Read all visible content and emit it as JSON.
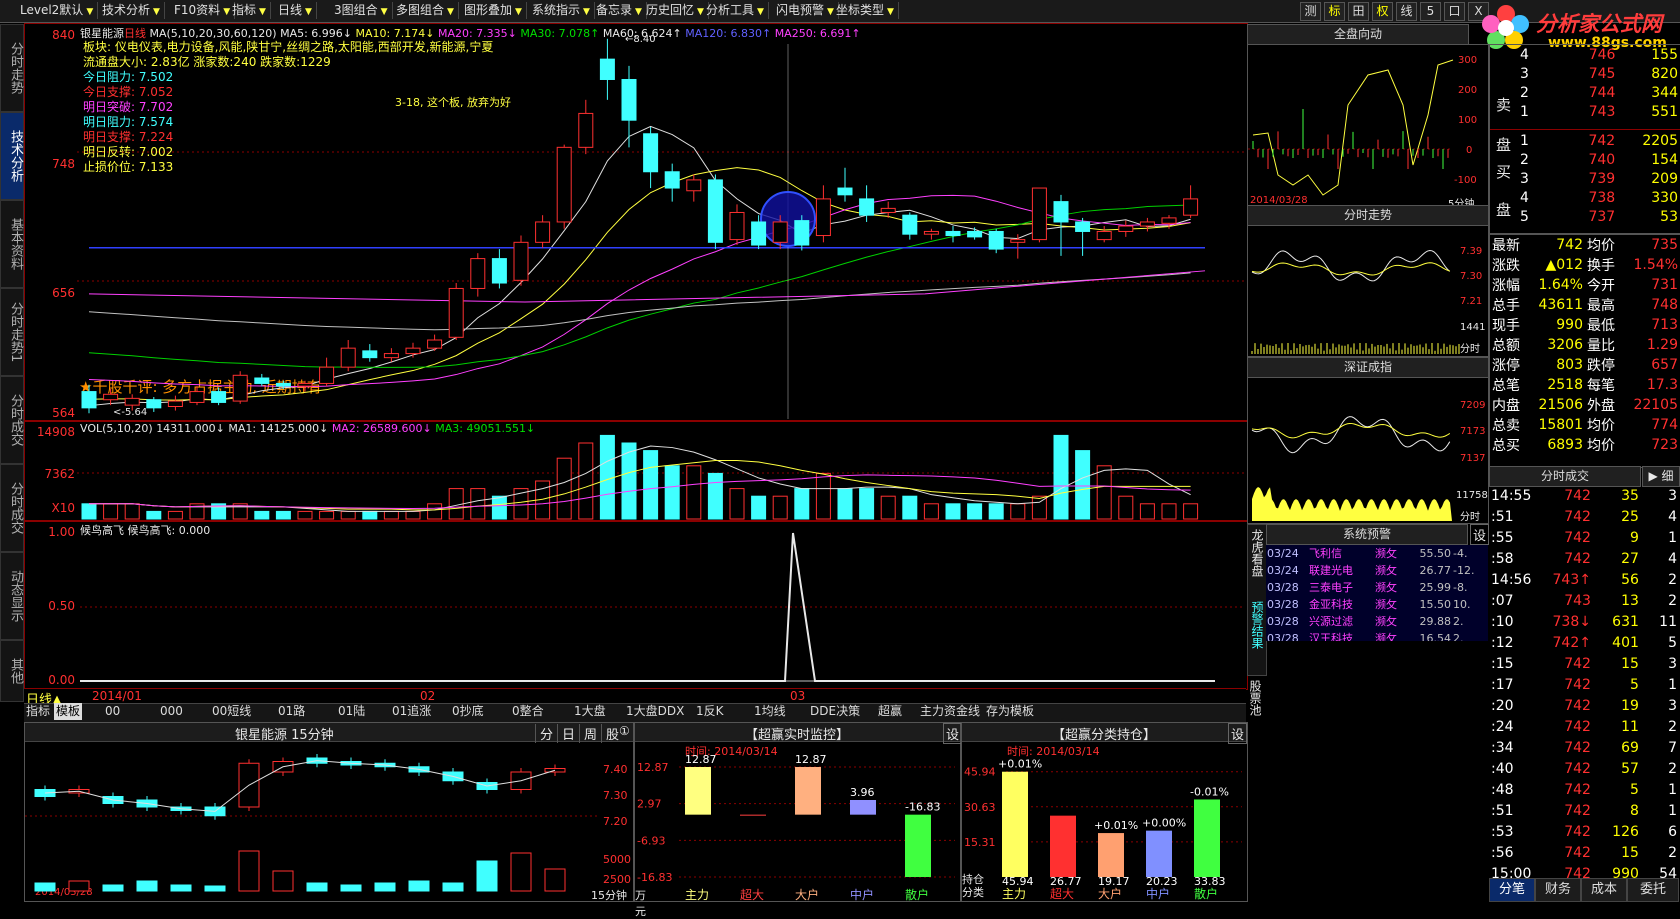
{
  "menu": [
    "Level2默认",
    "技术分析",
    "F10资料",
    "指标",
    "日线",
    "3图组合",
    "多图组合",
    "图形叠加",
    "系统指示",
    "备忘录",
    "历史回忆",
    "分析工具",
    "闪电预警",
    "坐标类型"
  ],
  "toolbar_icons": [
    "测",
    "标",
    "田",
    "权",
    "线",
    "5",
    "口",
    "X"
  ],
  "logo": {
    "name": "分析家公式网",
    "url": "www.88gs.com"
  },
  "side_tabs": [
    "分时走势",
    "技术分析",
    "基本资料",
    "分时走势1",
    "分时成交",
    "分时成交",
    "动态显示",
    "其他"
  ],
  "main_chart": {
    "stock": "银星能源",
    "period": "日线",
    "ma_header": "MA(5,10,20,30,60,120)",
    "ma5": "MA5: 6.996↓",
    "ma10": "MA10: 7.174↓",
    "ma20": "MA20: 7.335↓",
    "ma30": "MA30: 7.078↑",
    "ma60": "MA60: 6.624↑",
    "ma120": "MA120: 6.830↑",
    "ma250": "MA250: 6.691↑",
    "high_label": "8.40",
    "low_label": "5.64",
    "info": [
      "板块: 仪电仪表,电力设备,风能,陕甘宁,丝绸之路,太阳能,西部开发,新能源,宁夏",
      "流通盘大小: 2.83亿   涨家数:240    跌家数:1229",
      "今日阻力: 7.502",
      "今日支撑: 7.052",
      "明日突破: 7.702",
      "明日阻力: 7.574",
      "明日支撑: 7.224",
      "明日反转: 7.002",
      "止损价位: 7.133"
    ],
    "note": "3-18, 这个板, 放弃为好",
    "bottom_text": "★千股千评: 多方占据主动, 近期持有",
    "price_axis": [
      "840",
      "748",
      "656",
      "564"
    ]
  },
  "volume": {
    "header": "VOL(5,10,20)",
    "vol": "14311.000↓",
    "ma1": "MA1: 14125.000↓",
    "ma2": "MA2: 26589.600↓",
    "ma3": "MA3: 49051.551↓",
    "axis": [
      "14908",
      "7362",
      "X10"
    ]
  },
  "indicator": {
    "header": "候鸟高飞 候鸟高飞: 0.000",
    "axis": [
      "1.00",
      "0.50",
      "0.00"
    ],
    "date_bar": [
      "日线",
      "2014/01",
      "02",
      "03"
    ]
  },
  "ind_tabs": [
    "指标",
    "模板",
    "00",
    "000",
    "00短线",
    "01路",
    "01陆",
    "01追涨",
    "0抄底",
    "0整合",
    "1大盘",
    "1大盘DDX",
    "1反K",
    "1均线",
    "DDE决策",
    "超赢",
    "主力资金线",
    "存为模板"
  ],
  "mini_chart": {
    "title": "银星能源 15分钟",
    "buttons": [
      "分",
      "日",
      "周",
      "股",
      "①"
    ],
    "axis": [
      "7.40",
      "7.30",
      "7.20",
      "5000",
      "2500"
    ],
    "date": "2014/03/28",
    "footer": [
      "15分钟",
      "万元"
    ]
  },
  "monitor": {
    "title": "【超赢实时监控】",
    "set": "设",
    "time": "时间: 2014/03/14",
    "axis": [
      "12.87",
      "2.97",
      "-6.93",
      "-16.83"
    ],
    "bars": [
      {
        "label": "主力",
        "value": 12.87,
        "color": "#ffff80"
      },
      {
        "label": "超大",
        "value": 0,
        "color": "#ff4040"
      },
      {
        "label": "大户",
        "value": 12.87,
        "color": "#ffb080"
      },
      {
        "label": "中户",
        "value": 3.96,
        "color": "#9090ff"
      },
      {
        "label": "散户",
        "value": -16.83,
        "color": "#40ff40"
      }
    ]
  },
  "holding": {
    "title": "【超赢分类持仓】",
    "set": "设",
    "time": "时间: 2014/03/14",
    "axis": [
      "45.94",
      "30.63",
      "15.31"
    ],
    "row_labels": [
      "持仓",
      "分类"
    ],
    "bars": [
      {
        "label": "主力",
        "value": 45.94,
        "pct": "+0.01%",
        "color": "#ffff60"
      },
      {
        "label": "超大",
        "value": 26.77,
        "pct": "",
        "color": "#ff3030"
      },
      {
        "label": "大户",
        "value": 19.17,
        "pct": "+0.01%",
        "color": "#ffa070"
      },
      {
        "label": "中户",
        "value": 20.23,
        "pct": "+0.00%",
        "color": "#8090ff"
      },
      {
        "label": "散户",
        "value": 33.83,
        "pct": "-0.01%",
        "color": "#40ff40"
      }
    ]
  },
  "right_panels": {
    "market": "全盘向动",
    "market_date": "2014/03/28",
    "market_period": "5分钟",
    "market_axis": [
      "300",
      "200",
      "100",
      "0",
      "-100"
    ],
    "intraday": "分时走势",
    "intraday_axis": [
      "7.39",
      "7.30",
      "7.21",
      "1441"
    ],
    "intraday_label": "分时",
    "index": "深证成指",
    "index_axis": [
      "7209",
      "7173",
      "7137",
      "11758"
    ],
    "index_label": "分时",
    "alert": "系统预警",
    "alert_set": "设",
    "alerts": [
      [
        "03/24",
        "飞利信",
        "濒攵",
        "55.50",
        "-4."
      ],
      [
        "03/24",
        "联建光电",
        "濒攵",
        "26.77",
        "-12."
      ],
      [
        "03/28",
        "三泰电子",
        "濒攵",
        "25.99",
        "-8."
      ],
      [
        "03/28",
        "金亚科技",
        "濒攵",
        "15.50",
        "10."
      ],
      [
        "03/28",
        "兴源过滤",
        "濒攵",
        "29.88",
        "2."
      ],
      [
        "03/28",
        "汉王科技",
        "濒攵",
        "16.54",
        "2."
      ]
    ],
    "vtabs": [
      "龙虎看盘",
      "预警结果",
      "股票池"
    ]
  },
  "orderbook": {
    "sell_label": "卖盘",
    "buy_label": "买盘",
    "sell": [
      [
        "3",
        "745",
        "820"
      ],
      [
        "2",
        "744",
        "344"
      ],
      [
        "1",
        "743",
        "551"
      ]
    ],
    "sell_top": [
      "4",
      "746",
      "155"
    ],
    "buy": [
      [
        "1",
        "742",
        "2205"
      ],
      [
        "2",
        "740",
        "154"
      ],
      [
        "3",
        "739",
        "209"
      ],
      [
        "4",
        "738",
        "330"
      ],
      [
        "5",
        "737",
        "53"
      ]
    ]
  },
  "stats": [
    [
      "最新",
      "742",
      "均价",
      "735"
    ],
    [
      "涨跌",
      "▲012",
      "换手",
      "1.54%"
    ],
    [
      "涨幅",
      "1.64%",
      "今开",
      "731"
    ],
    [
      "总手",
      "43611",
      "最高",
      "748"
    ],
    [
      "现手",
      "990",
      "最低",
      "713"
    ],
    [
      "总额",
      "3206",
      "量比",
      "1.29"
    ],
    [
      "涨停",
      "803",
      "跌停",
      "657"
    ],
    [
      "总笔",
      "2518",
      "每笔",
      "17.3"
    ],
    [
      "内盘",
      "21506",
      "外盘",
      "22105"
    ],
    [
      "总卖",
      "15801",
      "均价",
      "774"
    ],
    [
      "总买",
      "6893",
      "均价",
      "723"
    ]
  ],
  "trades_title": "分时成交",
  "trades_btn": "细",
  "trades": [
    [
      "14:55",
      "742",
      "35",
      "3"
    ],
    [
      ":51",
      "742",
      "25",
      "4"
    ],
    [
      ":55",
      "742",
      "9",
      "1"
    ],
    [
      ":58",
      "742",
      "27",
      "4"
    ],
    [
      "14:56",
      "743↑",
      "56",
      "2"
    ],
    [
      ":07",
      "743",
      "13",
      "2"
    ],
    [
      ":10",
      "738↓",
      "631",
      "11"
    ],
    [
      ":12",
      "742↑",
      "401",
      "5"
    ],
    [
      ":15",
      "742",
      "15",
      "3"
    ],
    [
      ":17",
      "742",
      "5",
      "1"
    ],
    [
      ":20",
      "742",
      "19",
      "3"
    ],
    [
      ":24",
      "742",
      "11",
      "2"
    ],
    [
      ":34",
      "742",
      "69",
      "7"
    ],
    [
      ":40",
      "742",
      "57",
      "2"
    ],
    [
      ":48",
      "742",
      "5",
      "1"
    ],
    [
      ":51",
      "742",
      "8",
      "1"
    ],
    [
      ":53",
      "742",
      "126",
      "6"
    ],
    [
      ":56",
      "742",
      "15",
      "2"
    ],
    [
      "15:00",
      "742",
      "990",
      "54"
    ]
  ],
  "bottom_tabs": [
    "分笔",
    "财务",
    "成本",
    "委托"
  ],
  "candles": [
    {
      "o": 5.8,
      "c": 5.68,
      "h": 5.85,
      "l": 5.64
    },
    {
      "o": 5.74,
      "c": 5.78,
      "h": 5.82,
      "l": 5.7
    },
    {
      "o": 5.7,
      "c": 5.75,
      "h": 5.78,
      "l": 5.66
    },
    {
      "o": 5.74,
      "c": 5.68,
      "h": 5.76,
      "l": 5.65
    },
    {
      "o": 5.69,
      "c": 5.73,
      "h": 5.77,
      "l": 5.66
    },
    {
      "o": 5.72,
      "c": 5.8,
      "h": 5.84,
      "l": 5.7
    },
    {
      "o": 5.8,
      "c": 5.72,
      "h": 5.83,
      "l": 5.7
    },
    {
      "o": 5.73,
      "c": 5.92,
      "h": 5.95,
      "l": 5.71
    },
    {
      "o": 5.9,
      "c": 5.86,
      "h": 5.93,
      "l": 5.84
    },
    {
      "o": 5.86,
      "c": 5.84,
      "h": 5.88,
      "l": 5.82
    },
    {
      "o": 5.84,
      "c": 5.86,
      "h": 5.88,
      "l": 5.8
    },
    {
      "o": 5.86,
      "c": 5.98,
      "h": 6.05,
      "l": 5.84
    },
    {
      "o": 5.98,
      "c": 6.12,
      "h": 6.18,
      "l": 5.95
    },
    {
      "o": 6.1,
      "c": 6.05,
      "h": 6.15,
      "l": 6.02
    },
    {
      "o": 6.05,
      "c": 6.08,
      "h": 6.12,
      "l": 6.02
    },
    {
      "o": 6.08,
      "c": 6.12,
      "h": 6.16,
      "l": 6.05
    },
    {
      "o": 6.12,
      "c": 6.18,
      "h": 6.22,
      "l": 6.1
    },
    {
      "o": 6.2,
      "c": 6.56,
      "h": 6.6,
      "l": 6.18
    },
    {
      "o": 6.56,
      "c": 6.78,
      "h": 6.82,
      "l": 6.5
    },
    {
      "o": 6.78,
      "c": 6.6,
      "h": 6.85,
      "l": 6.56
    },
    {
      "o": 6.62,
      "c": 6.9,
      "h": 6.95,
      "l": 6.58
    },
    {
      "o": 6.9,
      "c": 7.05,
      "h": 7.1,
      "l": 6.86
    },
    {
      "o": 7.05,
      "c": 7.6,
      "h": 7.62,
      "l": 7.0
    },
    {
      "o": 7.6,
      "c": 7.85,
      "h": 7.95,
      "l": 7.55
    },
    {
      "o": 8.25,
      "c": 8.1,
      "h": 8.4,
      "l": 7.95
    },
    {
      "o": 8.1,
      "c": 7.8,
      "h": 8.2,
      "l": 7.6
    },
    {
      "o": 7.7,
      "c": 7.42,
      "h": 7.75,
      "l": 7.3
    },
    {
      "o": 7.42,
      "c": 7.3,
      "h": 7.48,
      "l": 7.2
    },
    {
      "o": 7.28,
      "c": 7.36,
      "h": 7.4,
      "l": 7.2
    },
    {
      "o": 7.36,
      "c": 6.9,
      "h": 7.4,
      "l": 6.85
    },
    {
      "o": 6.92,
      "c": 7.12,
      "h": 7.18,
      "l": 6.88
    },
    {
      "o": 7.05,
      "c": 6.88,
      "h": 7.1,
      "l": 6.85
    },
    {
      "o": 6.9,
      "c": 7.05,
      "h": 7.1,
      "l": 6.85
    },
    {
      "o": 7.06,
      "c": 6.88,
      "h": 7.1,
      "l": 6.84
    },
    {
      "o": 6.95,
      "c": 7.22,
      "h": 7.32,
      "l": 6.9
    },
    {
      "o": 7.3,
      "c": 7.25,
      "h": 7.45,
      "l": 7.2
    },
    {
      "o": 7.22,
      "c": 7.1,
      "h": 7.32,
      "l": 7.05
    },
    {
      "o": 7.12,
      "c": 7.15,
      "h": 7.2,
      "l": 7.08
    },
    {
      "o": 7.1,
      "c": 6.96,
      "h": 7.12,
      "l": 6.92
    },
    {
      "o": 6.96,
      "c": 6.98,
      "h": 7.0,
      "l": 6.92
    },
    {
      "o": 6.98,
      "c": 6.95,
      "h": 7.02,
      "l": 6.9
    },
    {
      "o": 6.98,
      "c": 6.94,
      "h": 7.01,
      "l": 6.92
    },
    {
      "o": 6.98,
      "c": 6.85,
      "h": 7.0,
      "l": 6.82
    },
    {
      "o": 6.9,
      "c": 6.92,
      "h": 6.96,
      "l": 6.78
    },
    {
      "o": 6.92,
      "c": 7.3,
      "h": 7.3,
      "l": 6.9
    },
    {
      "o": 7.2,
      "c": 7.05,
      "h": 7.25,
      "l": 6.8
    },
    {
      "o": 7.05,
      "c": 6.98,
      "h": 7.08,
      "l": 6.8
    },
    {
      "o": 6.92,
      "c": 6.98,
      "h": 7.02,
      "l": 6.9
    },
    {
      "o": 6.98,
      "c": 7.02,
      "h": 7.06,
      "l": 6.94
    },
    {
      "o": 7.02,
      "c": 7.05,
      "h": 7.08,
      "l": 6.98
    },
    {
      "o": 7.04,
      "c": 7.08,
      "h": 7.1,
      "l": 7.0
    },
    {
      "o": 7.1,
      "c": 7.22,
      "h": 7.32,
      "l": 7.08
    }
  ],
  "volumes": [
    2,
    2,
    2,
    1,
    1,
    2,
    2,
    2,
    1,
    1,
    1,
    1,
    1,
    1,
    1,
    1,
    2,
    4,
    4,
    3,
    4,
    5,
    8,
    10,
    11,
    10,
    9,
    7,
    7,
    6,
    4,
    3,
    3,
    4,
    6,
    4,
    4,
    3,
    3,
    2,
    2,
    2,
    2,
    2,
    3,
    11,
    9,
    7,
    3,
    2,
    2,
    2
  ]
}
